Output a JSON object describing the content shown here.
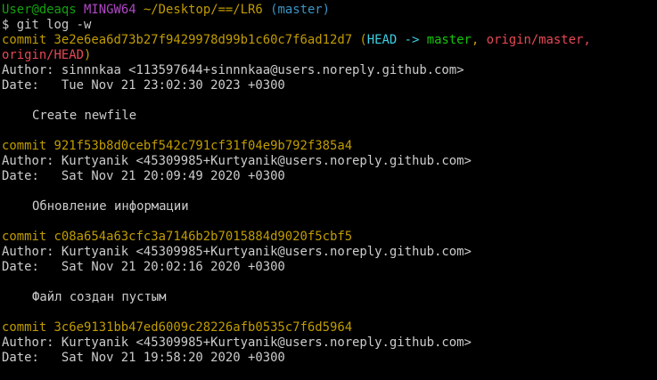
{
  "prompt": {
    "user_host": "User@deaqs",
    "system": "MINGW64",
    "path": "~/Desktop/==/LR6",
    "branch": "(master)"
  },
  "command": "$ git log -w",
  "commits": [
    {
      "hash_line": "commit 3e2e6ea6d73b27f9429978d99b1c60c7f6ad12d7",
      "refs": {
        "open": " (",
        "head": "HEAD -> ",
        "local": "master",
        "sep": ", ",
        "remote_master": "origin/master,",
        "remote_head": "origin/HEAD",
        "close": ")"
      },
      "author": "Author: sinnnkaa <113597644+sinnnkaa@users.noreply.github.com>",
      "date": "Date:   Tue Nov 21 23:02:30 2023 +0300",
      "message": "Create newfile"
    },
    {
      "hash_line": "commit 921f53b8d0cebf542c791cf31f04e9b792f385a4",
      "author": "Author: Kurtyanik <45309985+Kurtyanik@users.noreply.github.com>",
      "date": "Date:   Sat Nov 21 20:09:49 2020 +0300",
      "message": "Обновление информации"
    },
    {
      "hash_line": "commit c08a654a63cfc3a7146b2b7015884d9020f5cbf5",
      "author": "Author: Kurtyanik <45309985+Kurtyanik@users.noreply.github.com>",
      "date": "Date:   Sat Nov 21 20:02:16 2020 +0300",
      "message": "Файл создан пустым"
    },
    {
      "hash_line": "commit 3c6e9131bb47ed6009c28226afb0535c7f6d5964",
      "author": "Author: Kurtyanik <45309985+Kurtyanik@users.noreply.github.com>",
      "date": "Date:   Sat Nov 21 19:58:20 2020 +0300"
    }
  ],
  "colors": {
    "background": "#000000",
    "text": "#cccccc",
    "user": "#13a10e",
    "system": "#b148c6",
    "path": "#c19c00",
    "commit_hash": "#c19c00",
    "head_ref": "#3dd0e4",
    "local_branch": "#16c60c",
    "remote_branch": "#e74856"
  }
}
